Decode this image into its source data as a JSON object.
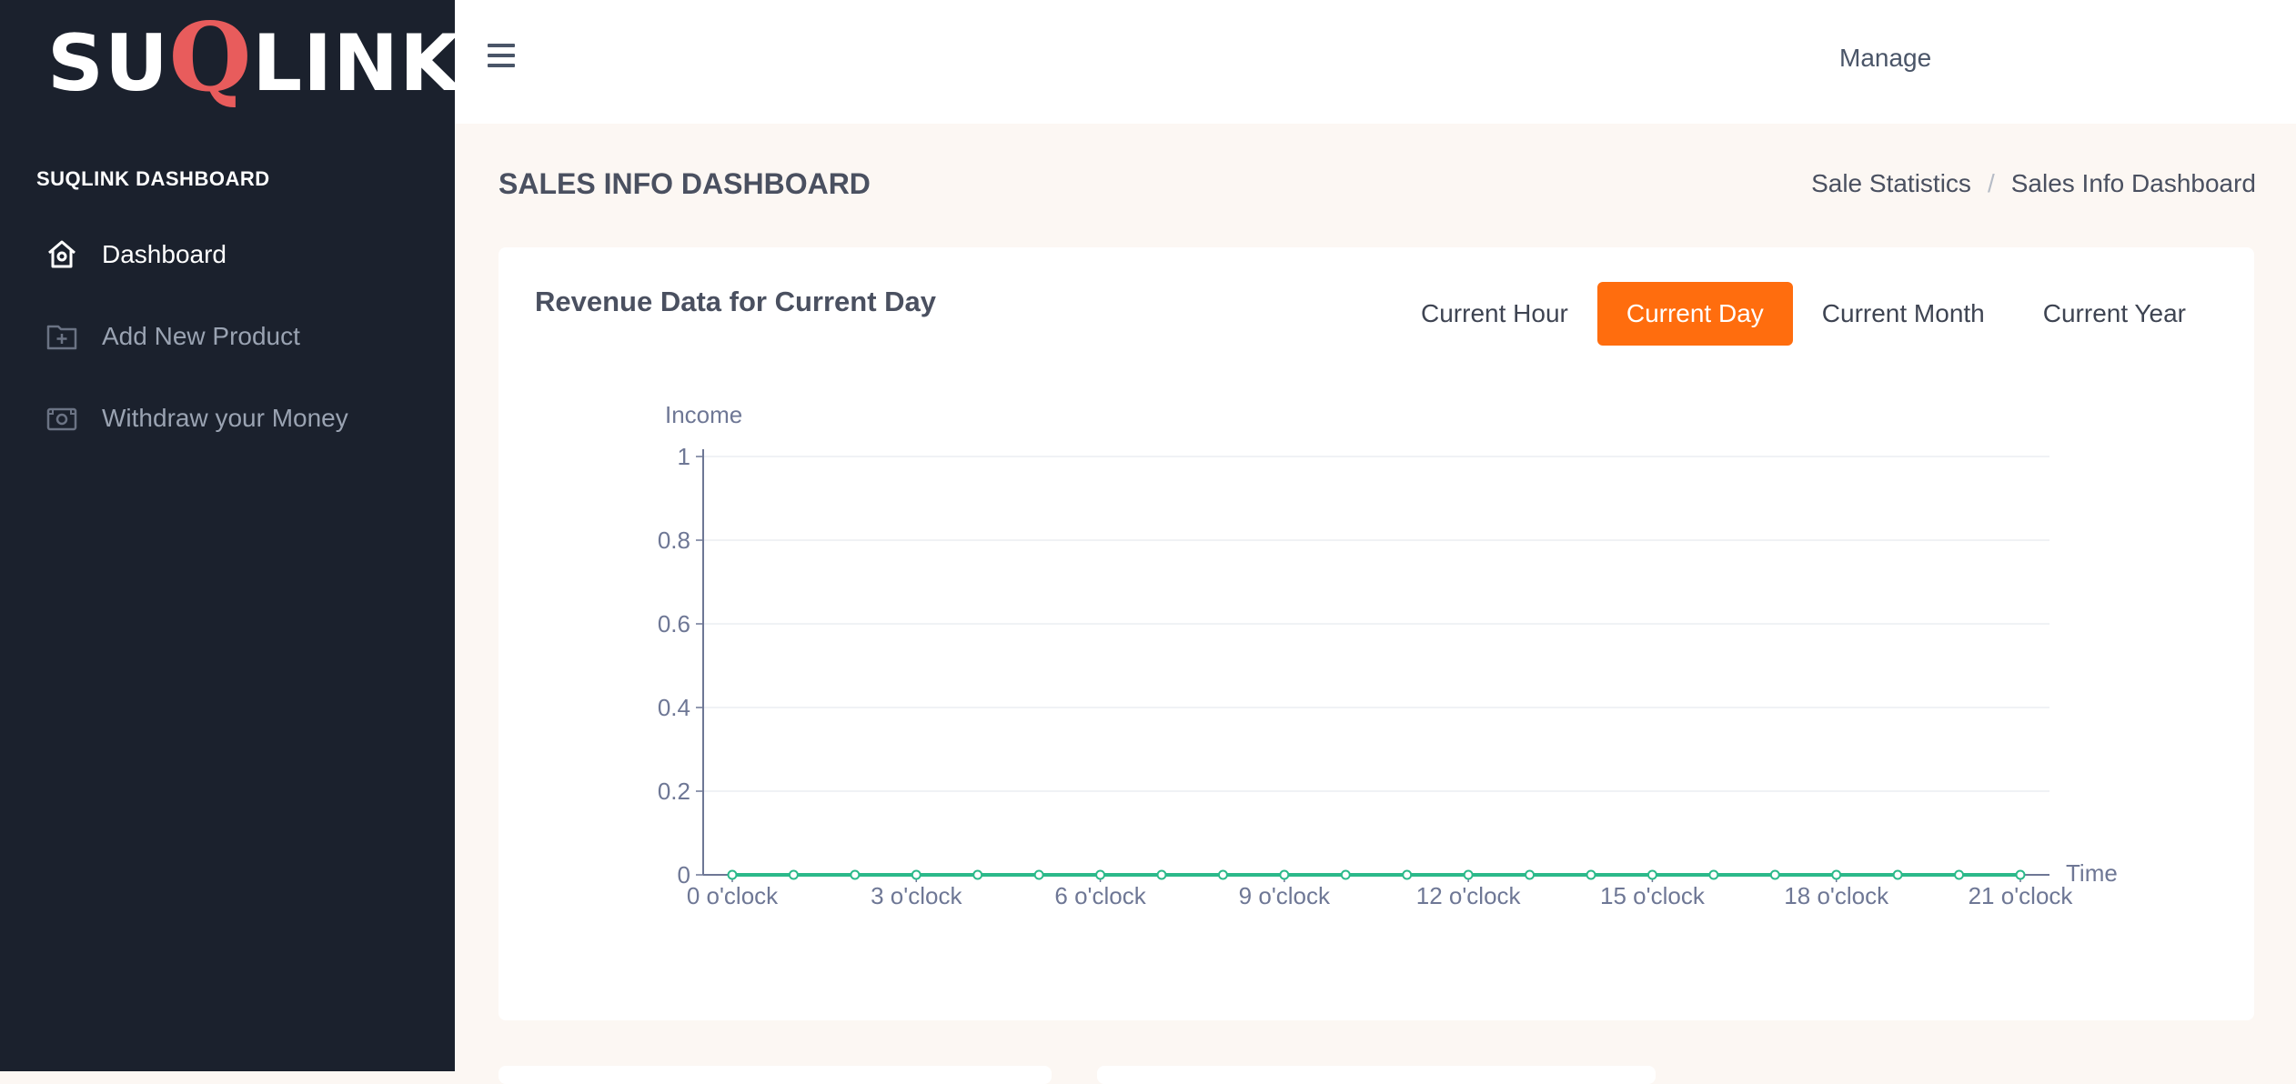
{
  "brand": {
    "logo_left": "SU",
    "logo_q": "Q",
    "logo_right": "LINK"
  },
  "sidebar": {
    "heading": "SUQLINK DASHBOARD",
    "items": [
      {
        "label": "Dashboard",
        "icon": "home-icon",
        "active": true
      },
      {
        "label": "Add New Product",
        "icon": "folder-plus-icon",
        "active": false
      },
      {
        "label": "Withdraw your Money",
        "icon": "money-icon",
        "active": false
      }
    ]
  },
  "topbar": {
    "manage_label": "Manage"
  },
  "page": {
    "title": "SALES INFO DASHBOARD",
    "breadcrumb": [
      "Sale Statistics",
      "Sales Info Dashboard"
    ],
    "breadcrumb_separator": "/"
  },
  "card": {
    "title": "Revenue Data for Current Day",
    "tabs": [
      {
        "label": "Current Hour",
        "active": false
      },
      {
        "label": "Current Day",
        "active": true
      },
      {
        "label": "Current Month",
        "active": false
      },
      {
        "label": "Current Year",
        "active": false
      }
    ]
  },
  "colors": {
    "accent": "#ff6d0e",
    "sidebar_bg": "#1b212d",
    "series_line": "#2bb98a",
    "axis": "#6e7795"
  },
  "chart_data": {
    "type": "line",
    "title": "",
    "xlabel": "Time",
    "ylabel": "Income",
    "ylim": [
      0,
      1
    ],
    "y_ticks": [
      "0",
      "0.2",
      "0.4",
      "0.6",
      "0.8",
      "1"
    ],
    "x": [
      "0 o'clock",
      "1 o'clock",
      "2 o'clock",
      "3 o'clock",
      "4 o'clock",
      "5 o'clock",
      "6 o'clock",
      "7 o'clock",
      "8 o'clock",
      "9 o'clock",
      "10 o'clock",
      "11 o'clock",
      "12 o'clock",
      "13 o'clock",
      "14 o'clock",
      "15 o'clock",
      "16 o'clock",
      "17 o'clock",
      "18 o'clock",
      "19 o'clock",
      "20 o'clock",
      "21 o'clock"
    ],
    "x_tick_labels_shown": [
      "0 o'clock",
      "3 o'clock",
      "6 o'clock",
      "9 o'clock",
      "12 o'clock",
      "15 o'clock",
      "18 o'clock",
      "21 o'clock"
    ],
    "series": [
      {
        "values": [
          0,
          0,
          0,
          0,
          0,
          0,
          0,
          0,
          0,
          0,
          0,
          0,
          0,
          0,
          0,
          0,
          0,
          0,
          0,
          0,
          0,
          0
        ]
      }
    ],
    "grid": true
  }
}
